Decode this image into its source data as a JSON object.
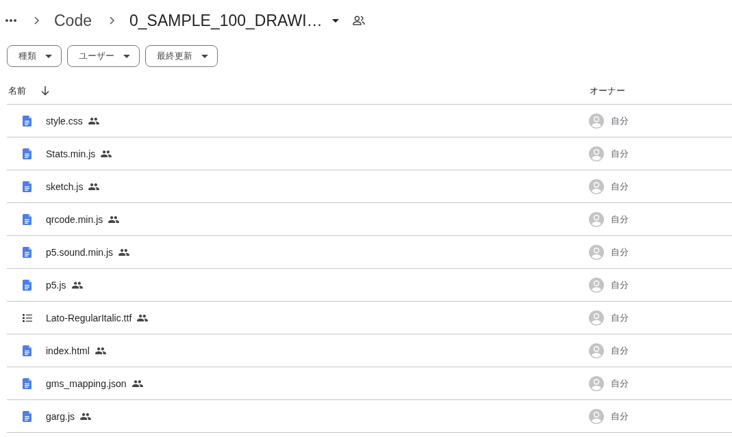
{
  "breadcrumb": {
    "parents": [
      {
        "label": "Code"
      }
    ],
    "current": {
      "label": "0_SAMPLE_100_DRAWI…",
      "shared": true
    }
  },
  "filters": [
    {
      "label": "種類"
    },
    {
      "label": "ユーザー"
    },
    {
      "label": "最終更新"
    }
  ],
  "table": {
    "columns": [
      {
        "label": "名前",
        "sorted": true
      },
      {
        "label": "オーナー",
        "sorted": false
      }
    ],
    "rows": [
      {
        "name": "style.css",
        "kind": "doc",
        "shared": true,
        "owner": "自分"
      },
      {
        "name": "Stats.min.js",
        "kind": "doc",
        "shared": true,
        "owner": "自分"
      },
      {
        "name": "sketch.js",
        "kind": "doc",
        "shared": true,
        "owner": "自分"
      },
      {
        "name": "qrcode.min.js",
        "kind": "doc",
        "shared": true,
        "owner": "自分"
      },
      {
        "name": "p5.sound.min.js",
        "kind": "doc",
        "shared": true,
        "owner": "自分"
      },
      {
        "name": "p5.js",
        "kind": "doc",
        "shared": true,
        "owner": "自分"
      },
      {
        "name": "Lato-RegularItalic.ttf",
        "kind": "list",
        "shared": true,
        "owner": "自分"
      },
      {
        "name": "index.html",
        "kind": "doc",
        "shared": true,
        "owner": "自分"
      },
      {
        "name": "gms_mapping.json",
        "kind": "doc",
        "shared": true,
        "owner": "自分"
      },
      {
        "name": "garg.js",
        "kind": "doc",
        "shared": true,
        "owner": "自分"
      }
    ]
  }
}
